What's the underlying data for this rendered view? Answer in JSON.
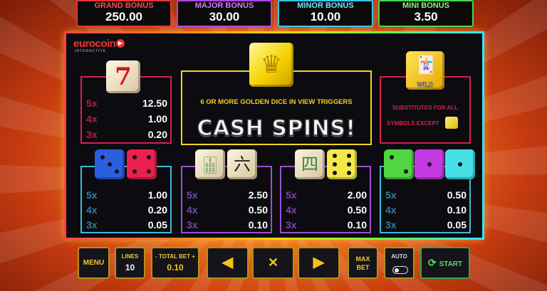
{
  "jackpots": {
    "grand": {
      "label": "GRAND BONUS",
      "value": "250.00"
    },
    "major": {
      "label": "MAJOR BONUS",
      "value": "30.00"
    },
    "minor": {
      "label": "MINOR BONUS",
      "value": "10.00"
    },
    "mini": {
      "label": "MINI BONUS",
      "value": "3.50"
    }
  },
  "logo": {
    "brand": "eurocoin",
    "sub": "INTERACTIVE"
  },
  "paytable": {
    "seven": {
      "symbol": "7",
      "rows": [
        {
          "mult": "5x",
          "pay": "12.50"
        },
        {
          "mult": "4x",
          "pay": "1.00"
        },
        {
          "mult": "3x",
          "pay": "0.20"
        }
      ]
    },
    "blue_red": {
      "rows": [
        {
          "mult": "5x",
          "pay": "1.00"
        },
        {
          "mult": "4x",
          "pay": "0.20"
        },
        {
          "mult": "3x",
          "pay": "0.05"
        }
      ]
    },
    "mahjong_six": {
      "glyph_a": "🀖",
      "glyph_b": "六",
      "rows": [
        {
          "mult": "5x",
          "pay": "2.50"
        },
        {
          "mult": "4x",
          "pay": "0.50"
        },
        {
          "mult": "3x",
          "pay": "0.10"
        }
      ]
    },
    "mahjong_four": {
      "glyph_a": "四",
      "rows": [
        {
          "mult": "5x",
          "pay": "2.00"
        },
        {
          "mult": "4x",
          "pay": "0.50"
        },
        {
          "mult": "3x",
          "pay": "0.10"
        }
      ]
    },
    "green_purple_cyan": {
      "rows": [
        {
          "mult": "5x",
          "pay": "0.50"
        },
        {
          "mult": "4x",
          "pay": "0.10"
        },
        {
          "mult": "3x",
          "pay": "0.05"
        }
      ]
    }
  },
  "trigger": {
    "text": "6 OR MORE GOLDEN DICE IN VIEW TRIGGERS",
    "title": "CASH  SPINS!",
    "crown": "♛"
  },
  "wild": {
    "label": "WILD",
    "line1": "SUBSTITUTES FOR ALL",
    "line2": "SYMBOLS EXCEPT",
    "jester": "🃏"
  },
  "controls": {
    "menu": "MENU",
    "lines_label": "LINES",
    "lines_value": "10",
    "bet_label": "- TOTAL BET +",
    "bet_value": "0.10",
    "left_arrow": "◀",
    "close": "✕",
    "right_arrow": "▶",
    "max_bet_1": "MAX",
    "max_bet_2": "BET",
    "auto": "AUTO",
    "start": "START",
    "start_icon": "⟳"
  },
  "colors": {
    "grand": "#e53535",
    "major": "#b043e6",
    "minor": "#35c6e8",
    "mini": "#47d64a",
    "gold": "#f0d51a",
    "red": "#d8204c"
  }
}
